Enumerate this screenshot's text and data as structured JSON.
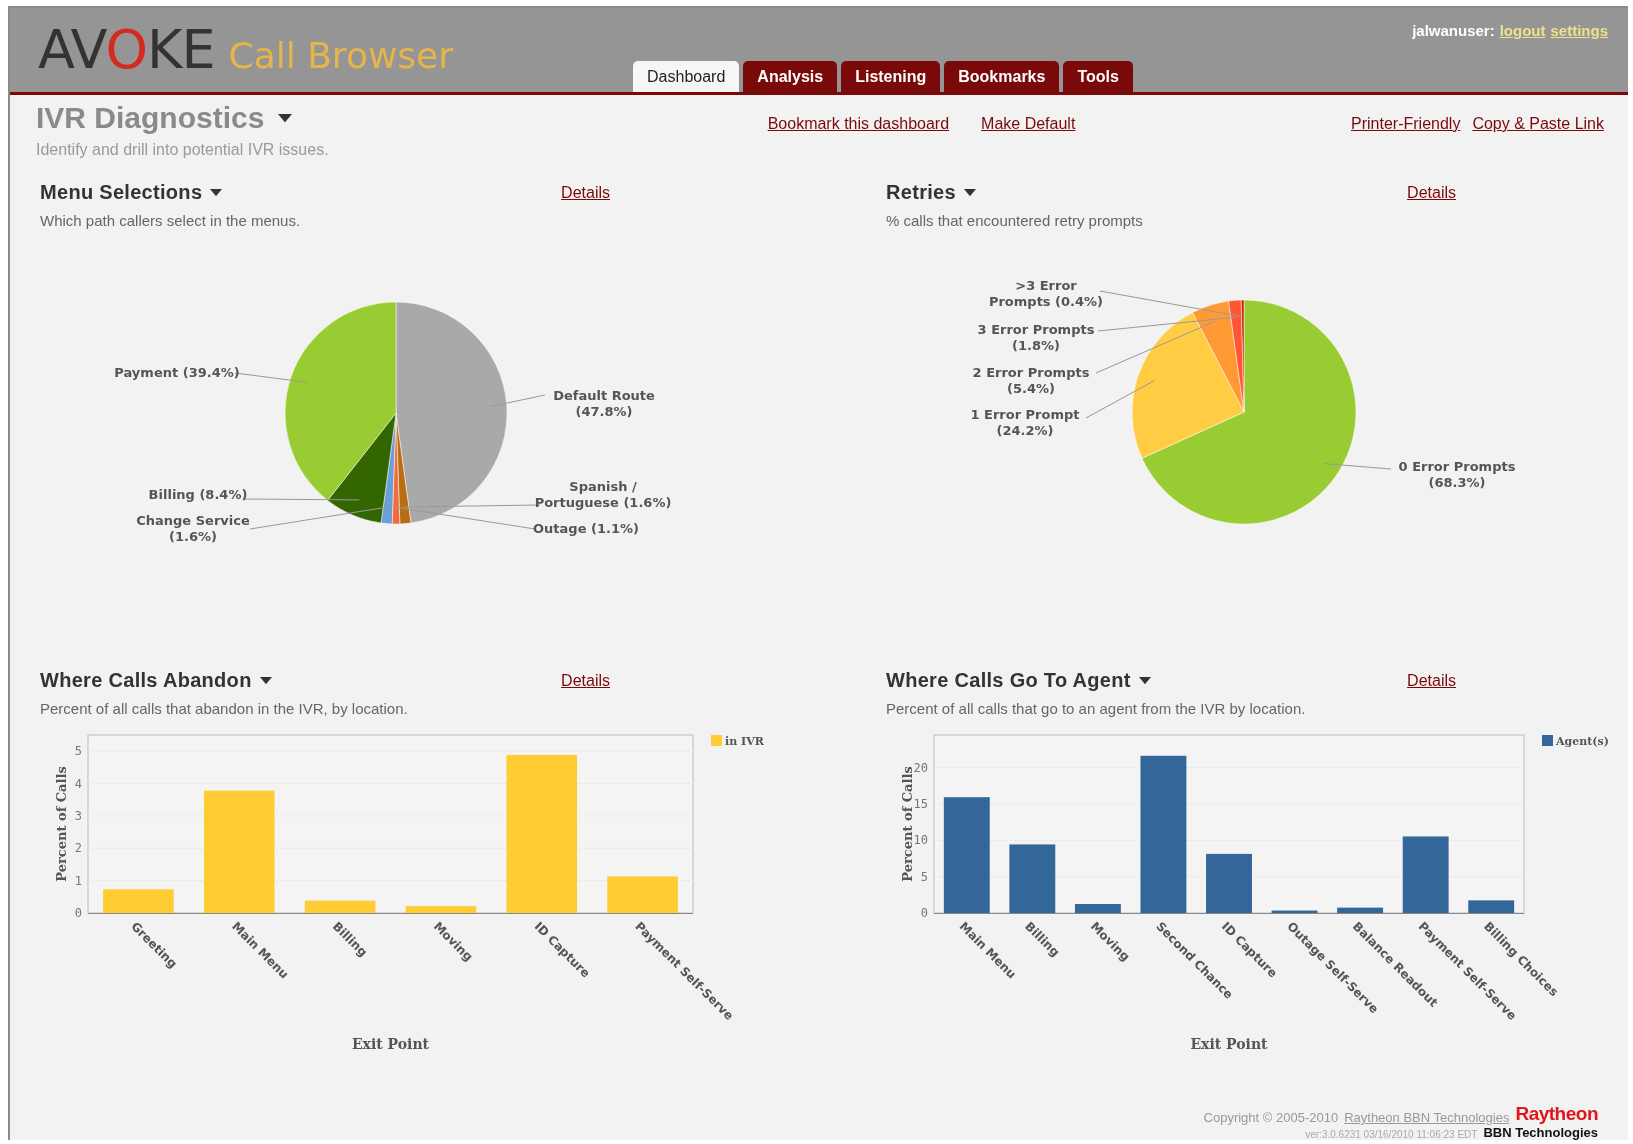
{
  "header": {
    "logo": {
      "parts": [
        {
          "text": "AV",
          "accent": false
        },
        {
          "text": "O",
          "accent": true
        },
        {
          "text": "KE",
          "accent": false
        }
      ],
      "product": "Call Browser"
    },
    "user": {
      "name": "jalwanuser:",
      "links": [
        "logout",
        "settings"
      ]
    },
    "tabs": [
      {
        "label": "Dashboard",
        "selected": true
      },
      {
        "label": "Analysis",
        "selected": false
      },
      {
        "label": "Listening",
        "selected": false
      },
      {
        "label": "Bookmarks",
        "selected": false
      },
      {
        "label": "Tools",
        "selected": false
      }
    ]
  },
  "dashboard": {
    "title": "IVR Diagnostics",
    "subtitle": "Identify and drill into potential IVR issues.",
    "actions": [
      "Bookmark this dashboard",
      "Make Default"
    ],
    "share_links": [
      "Printer-Friendly",
      "Copy & Paste Link"
    ]
  },
  "panels": [
    {
      "title": "Menu Selections",
      "details": "Details",
      "description": "Which path callers select in the menus.",
      "chart_data": {
        "type": "pie",
        "value_labels": [
          "Default Route (47.8%)",
          "Spanish / Portuguese (1.6%)",
          "Outage (1.1%)",
          "Change Service (1.6%)",
          "Billing (8.4%)",
          "Payment (39.4%)"
        ],
        "values": [
          47.8,
          1.6,
          1.1,
          1.6,
          8.4,
          39.4
        ],
        "colors": [
          "#a9a9a9",
          "#b86e10",
          "#f26b3a",
          "#6a9fd8",
          "#336600",
          "#99cc33"
        ]
      }
    },
    {
      "title": "Retries",
      "details": "Details",
      "description": "% calls that encountered retry prompts",
      "chart_data": {
        "type": "pie",
        "value_labels": [
          "0 Error Prompts (68.3%)",
          "1 Error Prompt (24.2%)",
          "2 Error Prompts (5.4%)",
          "3 Error Prompts (1.8%)",
          ">3 Error Prompts (0.4%)"
        ],
        "values": [
          68.3,
          24.2,
          5.4,
          1.8,
          0.4
        ],
        "colors": [
          "#99cc33",
          "#ffcc44",
          "#ff9933",
          "#ff5533",
          "#cc2200"
        ]
      }
    },
    {
      "title": "Where Calls Abandon",
      "details": "Details",
      "description": "Percent of all calls that abandon in the IVR, by location.",
      "chart_data": {
        "type": "bar",
        "xlabel": "Exit Point",
        "ylabel": "Percent of Calls",
        "categories": [
          "Greeting",
          "Main Menu",
          "Billing",
          "Moving",
          "ID Capture",
          "Payment Self-Serve"
        ],
        "series": [
          {
            "name": "in IVR",
            "color": "#ffcc33",
            "values": [
              0.7,
              3.75,
              0.35,
              0.18,
              4.85,
              1.1
            ]
          }
        ],
        "ylim": [
          0,
          5.5
        ],
        "yticks": [
          0,
          1,
          2,
          3,
          4,
          5
        ],
        "grid": true
      }
    },
    {
      "title": "Where Calls Go To Agent",
      "details": "Details",
      "description": "Percent of all calls that go to an agent from the IVR by location.",
      "chart_data": {
        "type": "bar",
        "xlabel": "Exit Point",
        "ylabel": "Percent of Calls",
        "categories": [
          "Main Menu",
          "Billing",
          "Moving",
          "Second Chance",
          "ID Capture",
          "Outage Self-Serve",
          "Balance Readout",
          "Payment Self-Serve",
          "Billing Choices"
        ],
        "series": [
          {
            "name": "Agent(s)",
            "color": "#336699",
            "values": [
              15.8,
              9.3,
              1.1,
              21.5,
              8.0,
              0.2,
              0.6,
              10.4,
              1.6
            ]
          }
        ],
        "ylim": [
          0,
          24.5
        ],
        "yticks": [
          0,
          5,
          10,
          15,
          20
        ],
        "grid": true
      }
    }
  ],
  "footer": {
    "copyright": "Copyright © 2005-2010",
    "company_link": "Raytheon BBN Technologies",
    "version": "ver:3.0.6231 03/16/2010 11:06:23 EDT",
    "brand": "Raytheon",
    "brand_sub": "BBN Technologies"
  }
}
